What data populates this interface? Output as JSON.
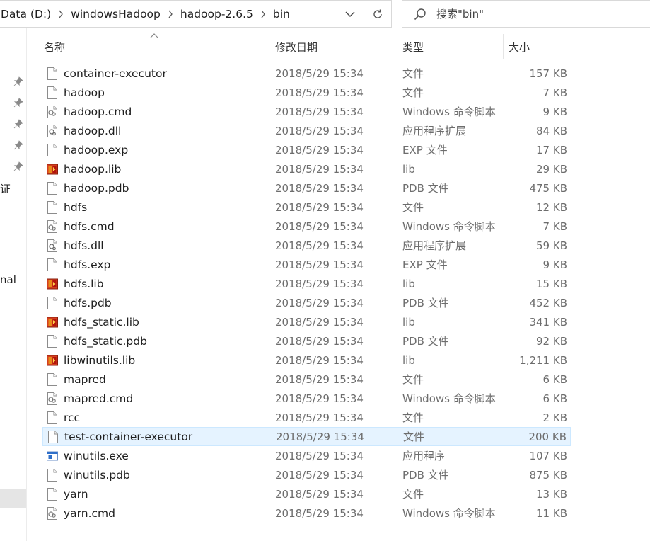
{
  "address": {
    "crumbs": [
      "Data (D:)",
      "windowsHadoop",
      "hadoop-2.6.5",
      "bin"
    ]
  },
  "search": {
    "placeholder": "搜索\"bin\""
  },
  "nav": {
    "fragments": [
      "证",
      "nal"
    ]
  },
  "columns": {
    "name": "名称",
    "date": "修改日期",
    "type": "类型",
    "size": "大小"
  },
  "files": [
    {
      "name": "container-executor",
      "date": "2018/5/29 15:34",
      "type": "文件",
      "size": "157 KB",
      "icon": "file-icon"
    },
    {
      "name": "hadoop",
      "date": "2018/5/29 15:34",
      "type": "文件",
      "size": "7 KB",
      "icon": "file-icon"
    },
    {
      "name": "hadoop.cmd",
      "date": "2018/5/29 15:34",
      "type": "Windows 命令脚本",
      "size": "9 KB",
      "icon": "cmd-icon"
    },
    {
      "name": "hadoop.dll",
      "date": "2018/5/29 15:34",
      "type": "应用程序扩展",
      "size": "84 KB",
      "icon": "dll-icon"
    },
    {
      "name": "hadoop.exp",
      "date": "2018/5/29 15:34",
      "type": "EXP 文件",
      "size": "17 KB",
      "icon": "file-icon"
    },
    {
      "name": "hadoop.lib",
      "date": "2018/5/29 15:34",
      "type": "lib",
      "size": "29 KB",
      "icon": "lib-icon"
    },
    {
      "name": "hadoop.pdb",
      "date": "2018/5/29 15:34",
      "type": "PDB 文件",
      "size": "475 KB",
      "icon": "file-icon"
    },
    {
      "name": "hdfs",
      "date": "2018/5/29 15:34",
      "type": "文件",
      "size": "12 KB",
      "icon": "file-icon"
    },
    {
      "name": "hdfs.cmd",
      "date": "2018/5/29 15:34",
      "type": "Windows 命令脚本",
      "size": "7 KB",
      "icon": "cmd-icon"
    },
    {
      "name": "hdfs.dll",
      "date": "2018/5/29 15:34",
      "type": "应用程序扩展",
      "size": "59 KB",
      "icon": "dll-icon"
    },
    {
      "name": "hdfs.exp",
      "date": "2018/5/29 15:34",
      "type": "EXP 文件",
      "size": "9 KB",
      "icon": "file-icon"
    },
    {
      "name": "hdfs.lib",
      "date": "2018/5/29 15:34",
      "type": "lib",
      "size": "15 KB",
      "icon": "lib-icon"
    },
    {
      "name": "hdfs.pdb",
      "date": "2018/5/29 15:34",
      "type": "PDB 文件",
      "size": "452 KB",
      "icon": "file-icon"
    },
    {
      "name": "hdfs_static.lib",
      "date": "2018/5/29 15:34",
      "type": "lib",
      "size": "341 KB",
      "icon": "lib-icon"
    },
    {
      "name": "hdfs_static.pdb",
      "date": "2018/5/29 15:34",
      "type": "PDB 文件",
      "size": "92 KB",
      "icon": "file-icon"
    },
    {
      "name": "libwinutils.lib",
      "date": "2018/5/29 15:34",
      "type": "lib",
      "size": "1,211 KB",
      "icon": "lib-icon"
    },
    {
      "name": "mapred",
      "date": "2018/5/29 15:34",
      "type": "文件",
      "size": "6 KB",
      "icon": "file-icon"
    },
    {
      "name": "mapred.cmd",
      "date": "2018/5/29 15:34",
      "type": "Windows 命令脚本",
      "size": "6 KB",
      "icon": "cmd-icon"
    },
    {
      "name": "rcc",
      "date": "2018/5/29 15:34",
      "type": "文件",
      "size": "2 KB",
      "icon": "file-icon"
    },
    {
      "name": "test-container-executor",
      "date": "2018/5/29 15:34",
      "type": "文件",
      "size": "200 KB",
      "icon": "file-icon",
      "highlighted": true
    },
    {
      "name": "winutils.exe",
      "date": "2018/5/29 15:34",
      "type": "应用程序",
      "size": "107 KB",
      "icon": "exe-icon"
    },
    {
      "name": "winutils.pdb",
      "date": "2018/5/29 15:34",
      "type": "PDB 文件",
      "size": "875 KB",
      "icon": "file-icon"
    },
    {
      "name": "yarn",
      "date": "2018/5/29 15:34",
      "type": "文件",
      "size": "13 KB",
      "icon": "file-icon"
    },
    {
      "name": "yarn.cmd",
      "date": "2018/5/29 15:34",
      "type": "Windows 命令脚本",
      "size": "11 KB",
      "icon": "cmd-icon"
    }
  ]
}
